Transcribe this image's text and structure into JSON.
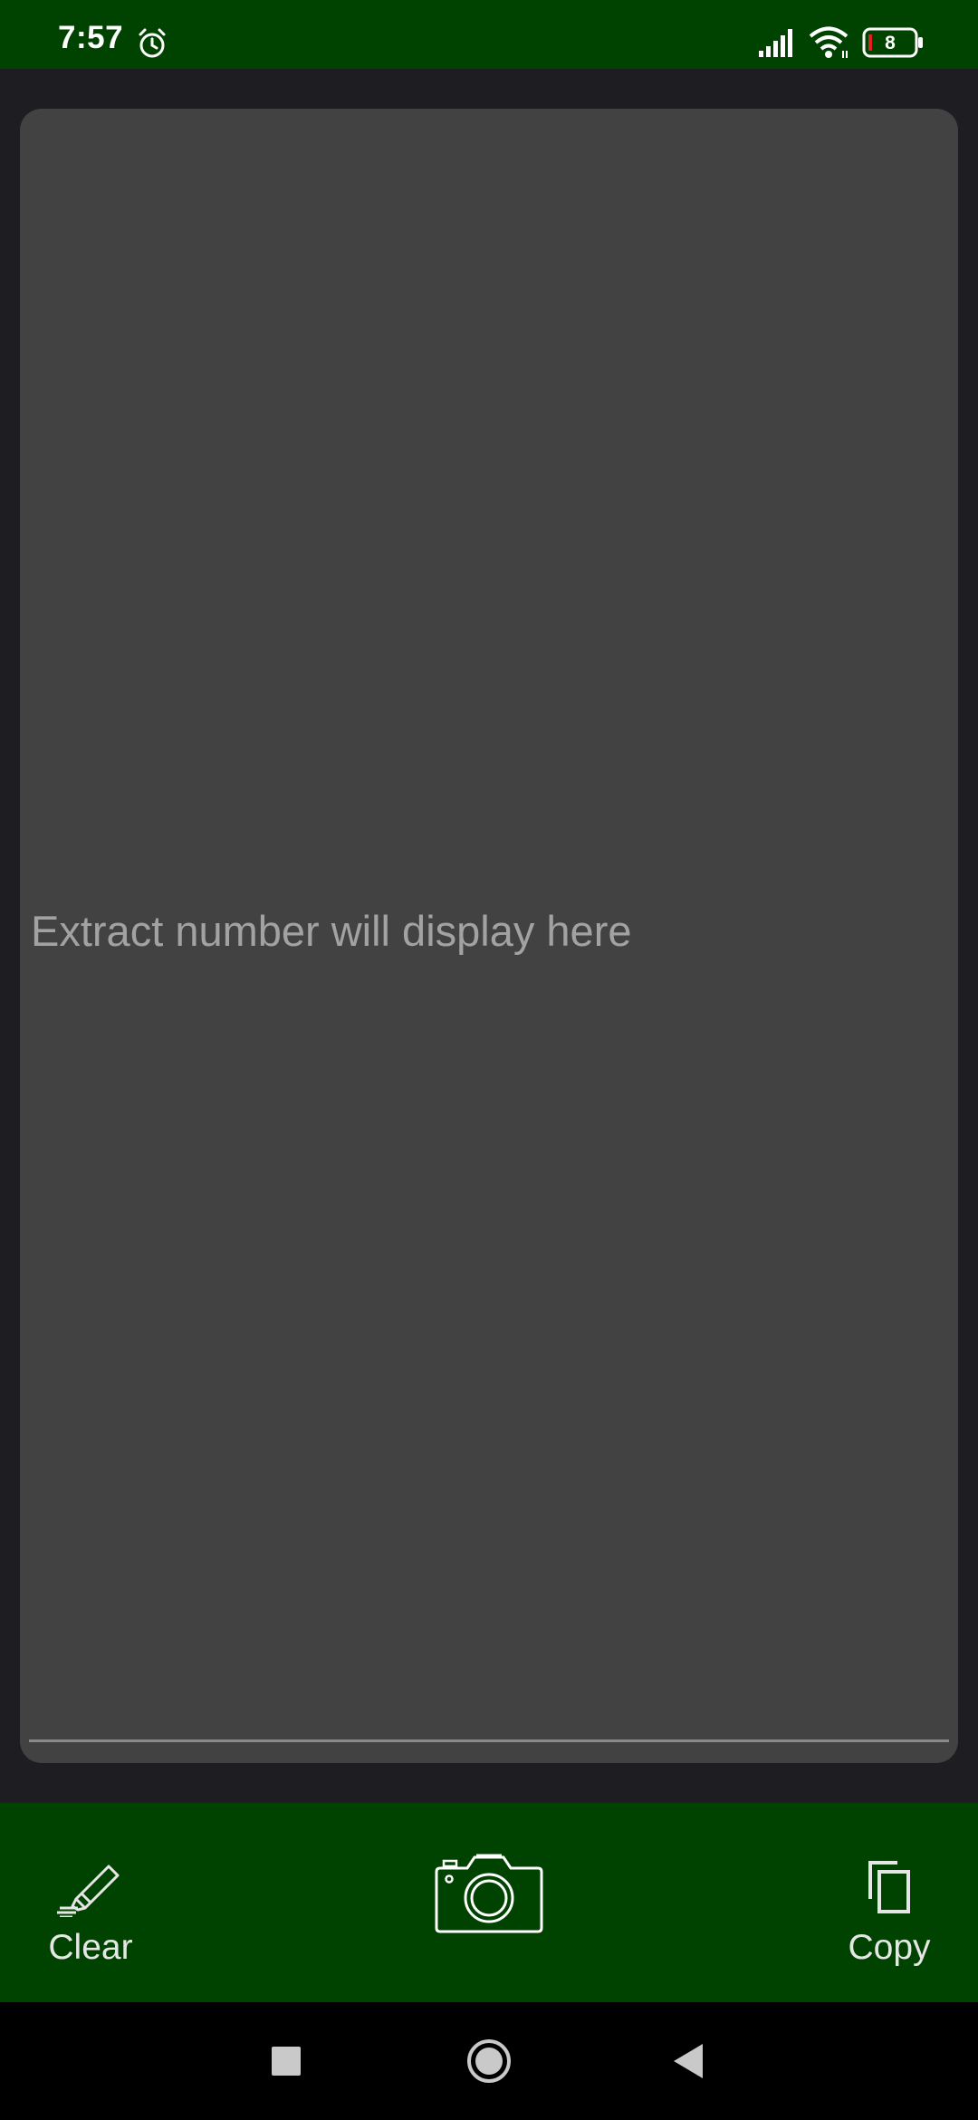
{
  "status_bar": {
    "time": "7:57",
    "battery_level": "8",
    "icons": [
      "alarm-icon",
      "signal-icon",
      "wifi-icon",
      "battery-icon"
    ]
  },
  "result": {
    "placeholder": "Extract number will display here",
    "value": ""
  },
  "bottom_bar": {
    "clear_label": "Clear",
    "copy_label": "Copy",
    "icons": [
      "highlighter-icon",
      "camera-icon",
      "copy-icon"
    ]
  },
  "nav_bar": {
    "icons": [
      "recents-square-icon",
      "home-circle-icon",
      "back-triangle-icon"
    ]
  },
  "colors": {
    "accent_green": "#004300",
    "card": "#424242",
    "background": "#1e1d22",
    "placeholder_text": "#a2a2a2"
  }
}
